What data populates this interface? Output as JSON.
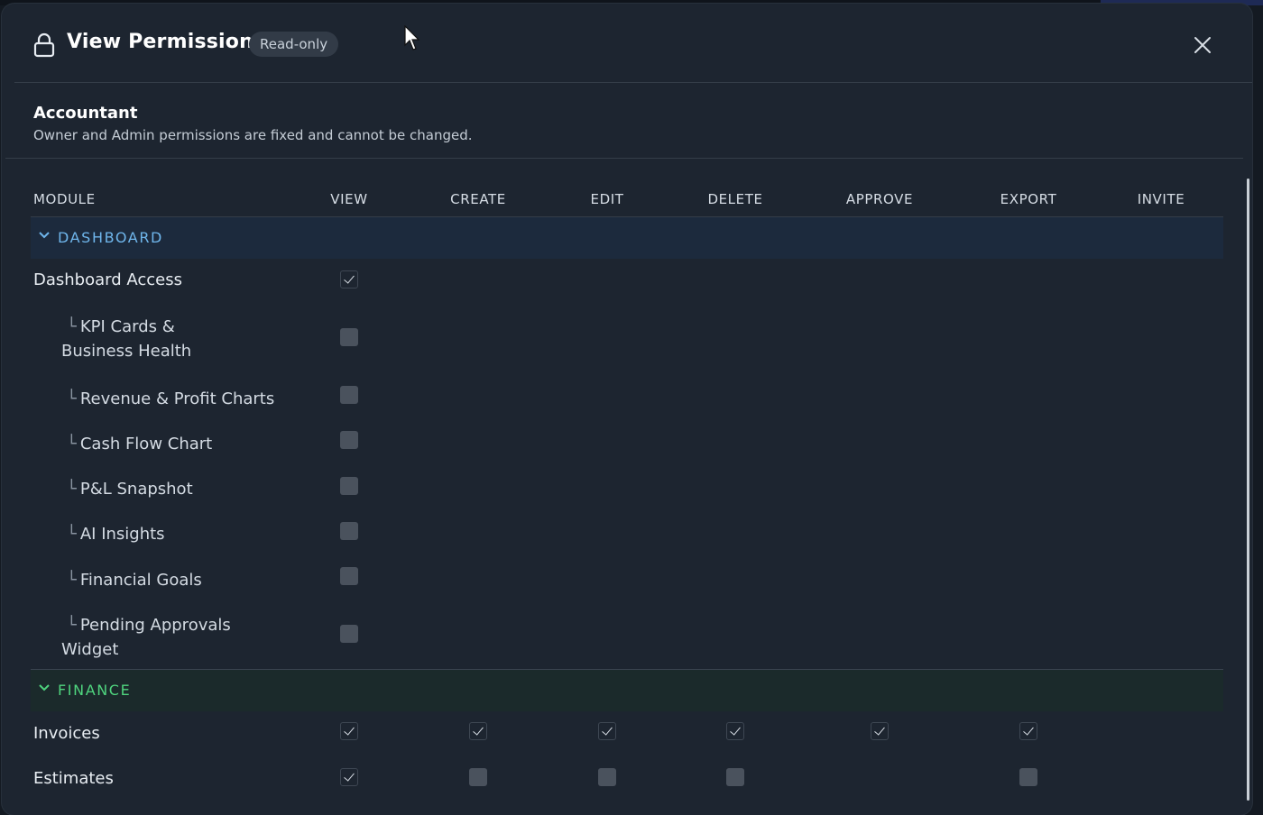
{
  "modal": {
    "title": "View Permissions",
    "badge": "Read-only",
    "role_name": "Accountant",
    "role_description": "Owner and Admin permissions are fixed and cannot be changed."
  },
  "columns": [
    "MODULE",
    "VIEW",
    "CREATE",
    "EDIT",
    "DELETE",
    "APPROVE",
    "EXPORT",
    "INVITE"
  ],
  "sections": [
    {
      "label": "DASHBOARD",
      "color": "#6fb6ec",
      "rows": [
        {
          "label": "Dashboard Access",
          "sub": false,
          "perms": [
            true,
            null,
            null,
            null,
            null,
            null,
            null
          ]
        },
        {
          "label": "KPI Cards & Business Health",
          "sub": true,
          "perms": [
            false,
            null,
            null,
            null,
            null,
            null,
            null
          ]
        },
        {
          "label": "Revenue & Profit Charts",
          "sub": true,
          "perms": [
            false,
            null,
            null,
            null,
            null,
            null,
            null
          ]
        },
        {
          "label": "Cash Flow Chart",
          "sub": true,
          "perms": [
            false,
            null,
            null,
            null,
            null,
            null,
            null
          ]
        },
        {
          "label": "P&L Snapshot",
          "sub": true,
          "perms": [
            false,
            null,
            null,
            null,
            null,
            null,
            null
          ]
        },
        {
          "label": "AI Insights",
          "sub": true,
          "perms": [
            false,
            null,
            null,
            null,
            null,
            null,
            null
          ]
        },
        {
          "label": "Financial Goals",
          "sub": true,
          "perms": [
            false,
            null,
            null,
            null,
            null,
            null,
            null
          ]
        },
        {
          "label": "Pending Approvals Widget",
          "sub": true,
          "perms": [
            false,
            null,
            null,
            null,
            null,
            null,
            null
          ]
        }
      ]
    },
    {
      "label": "FINANCE",
      "color": "#4fd47e",
      "rows": [
        {
          "label": "Invoices",
          "sub": false,
          "perms": [
            true,
            true,
            true,
            true,
            true,
            true,
            null
          ]
        },
        {
          "label": "Estimates",
          "sub": false,
          "perms": [
            true,
            false,
            false,
            false,
            null,
            false,
            null
          ]
        }
      ]
    }
  ],
  "icons": {
    "title": "lock-icon",
    "close": "close-icon",
    "section_toggle": "chevron-down-icon",
    "tree": "└"
  }
}
